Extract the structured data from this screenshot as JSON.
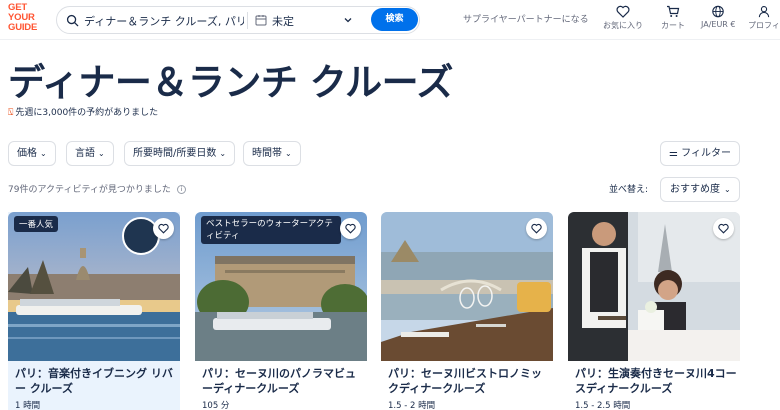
{
  "header": {
    "logo_lines": [
      "GET",
      "YOUR",
      "GUIDE"
    ],
    "search_value": "ディナー＆ランチ クルーズ, パリ",
    "date_value": "未定",
    "search_button": "検索",
    "supplier_link": "サプライヤーパートナーになる",
    "nav": [
      {
        "label": "お気に入り",
        "icon": "heart-icon"
      },
      {
        "label": "カート",
        "icon": "cart-icon"
      },
      {
        "label": "JA/EUR €",
        "icon": "globe-icon"
      },
      {
        "label": "プロフィ",
        "icon": "profile-icon"
      }
    ]
  },
  "page": {
    "title": "ディナー＆ランチ クルーズ",
    "booked_text": "先週に3,000件の予約がありました"
  },
  "filters": {
    "items": [
      "価格",
      "言語",
      "所要時間/所要日数",
      "時間帯"
    ],
    "filter_button": "フィルター",
    "results_text": "79件のアクティビティが見つかりました",
    "sort_label": "並べ替え:",
    "sort_value": "おすすめ度"
  },
  "cards": [
    {
      "badge": "一番人気",
      "title": "パリ：音楽付きイブニング リバー クルーズ",
      "duration": "1 時間"
    },
    {
      "badge": "ベストセラーのウォーターアクティビティ",
      "title": "パリ：セーヌ川のパノラマビューディナークルーズ",
      "duration": "105 分"
    },
    {
      "badge": "",
      "title": "パリ：セーヌ川ビストロノミックディナークルーズ",
      "duration": "1.5 - 2 時間"
    },
    {
      "badge": "",
      "title": "パリ：生演奏付きセーヌ川4コースディナークルーズ",
      "duration": "1.5 - 2.5 時間"
    }
  ],
  "colors": {
    "brand": "#ff5533",
    "accent": "#0071eb",
    "text": "#1a2b49"
  }
}
